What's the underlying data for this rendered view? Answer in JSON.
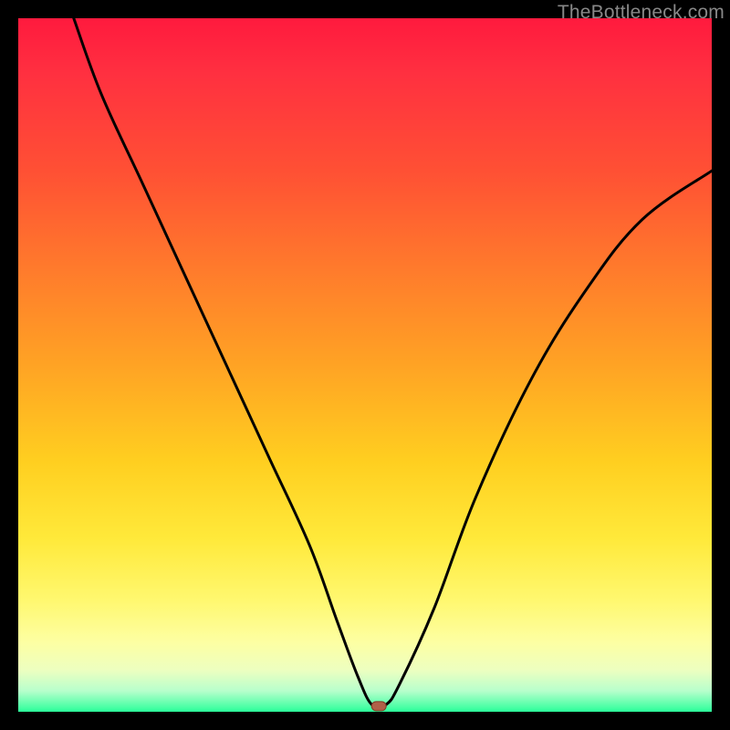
{
  "watermark": "TheBottleneck.com",
  "chart_data": {
    "type": "line",
    "title": "",
    "xlabel": "",
    "ylabel": "",
    "xlim": [
      0,
      100
    ],
    "ylim": [
      0,
      100
    ],
    "grid": false,
    "legend": false,
    "series": [
      {
        "name": "bottleneck-curve",
        "x": [
          8,
          12,
          18,
          24,
          30,
          36,
          42,
          46,
          49,
          51,
          53,
          55,
          60,
          66,
          74,
          82,
          90,
          100
        ],
        "y": [
          100,
          89,
          76,
          63,
          50,
          37,
          24,
          13,
          5,
          1,
          1,
          4,
          15,
          31,
          48,
          61,
          71,
          78
        ]
      }
    ],
    "marker": {
      "x": 52,
      "y": 0.8
    },
    "background_gradient": {
      "stops": [
        {
          "pos": 0,
          "color": "#ff1a3e"
        },
        {
          "pos": 50,
          "color": "#ffa324"
        },
        {
          "pos": 75,
          "color": "#ffe93a"
        },
        {
          "pos": 100,
          "color": "#2bff9a"
        }
      ]
    }
  }
}
